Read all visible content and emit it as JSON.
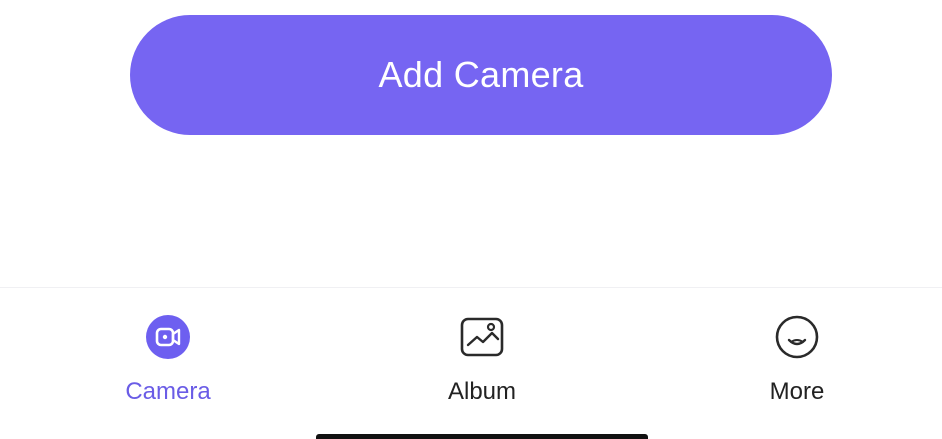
{
  "add_camera": {
    "label": "Add Camera"
  },
  "tabbar": {
    "tabs": [
      {
        "label": "Camera",
        "icon": "camera-icon",
        "active": true
      },
      {
        "label": "Album",
        "icon": "album-icon",
        "active": false
      },
      {
        "label": "More",
        "icon": "more-icon",
        "active": false
      }
    ]
  },
  "colors": {
    "accent": "#7665f2",
    "active_tab_text": "#6a5ce6",
    "inactive_tab_text": "#222222"
  }
}
